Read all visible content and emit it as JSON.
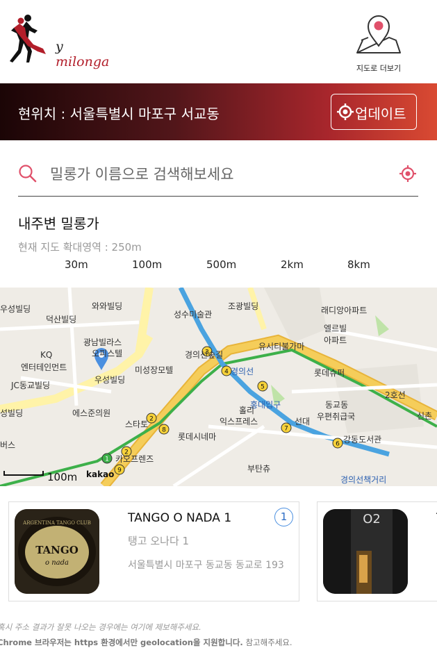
{
  "header": {
    "logo_text_prefix": "y ",
    "logo_text_suffix": "milonga",
    "map_more_label": "지도로 더보기"
  },
  "location": {
    "current": "현위치 : 서울특별시 마포구 서교동",
    "update_label": "업데이트"
  },
  "search": {
    "placeholder": "밀롱가 이름으로 검색해보세요"
  },
  "nearby": {
    "title": "내주변 밀롱가",
    "zoom_label": "현재 지도 확대영역 : ",
    "zoom_value": "250m",
    "zoom_options": [
      "30m",
      "100m",
      "500m",
      "2km",
      "8km"
    ]
  },
  "map": {
    "labels": [
      "우성빌딩",
      "와와빌딩",
      "덕산빌딩",
      "성수미술관",
      "조광빌딩",
      "래디앙아파트",
      "엘르빌",
      "아파트",
      "광남빌라스",
      "오피스텔",
      "KQ",
      "엔터테인먼트",
      "유시티불가마",
      "미성장모텔",
      "경의선숲길",
      "우성빌딩",
      "롯데슈퍼",
      "JC동교빌딩",
      "경의선",
      "홍대입구",
      "동교동",
      "우편취급국",
      "2호선",
      "신촌",
      "성빌딩",
      "에스준의원",
      "스타토",
      "홀리",
      "익스프레스",
      "선대",
      "롯데시네마",
      "강동도서관",
      "버스",
      "카오프렌즈",
      "부탄츄",
      "경의선책거리"
    ],
    "scale_label": "100m",
    "provider": "kakao",
    "station_numbers": [
      "3",
      "4",
      "5",
      "2",
      "8",
      "7",
      "6",
      "9",
      "1",
      "2"
    ]
  },
  "cards": [
    {
      "name": "TANGO O NADA 1",
      "korean_name": "탱고 오나다 1",
      "address": "서울특별시 마포구 동교동 동교로 193",
      "badge": "1",
      "thumb_text_top": "ARGENTINA TANGO CLUB",
      "thumb_text_main": "TANGO",
      "thumb_text_sub": "o nada"
    },
    {
      "name": "T",
      "thumb_text": "O2"
    }
  ],
  "notes": {
    "line1": "혹시 주소 결과가 잘못 나오는 경우에는 여기에 제보해주세요.",
    "line2_bold": "Chrome 브라우저는 https 환경에서만 geolocation을 지원합니다.",
    "line2_rest": " 참고해주세요."
  },
  "colors": {
    "accent": "#e0506a",
    "banner_dark": "#1b0506",
    "banner_light": "#d94a32",
    "badge_blue": "#4a8fe0"
  }
}
